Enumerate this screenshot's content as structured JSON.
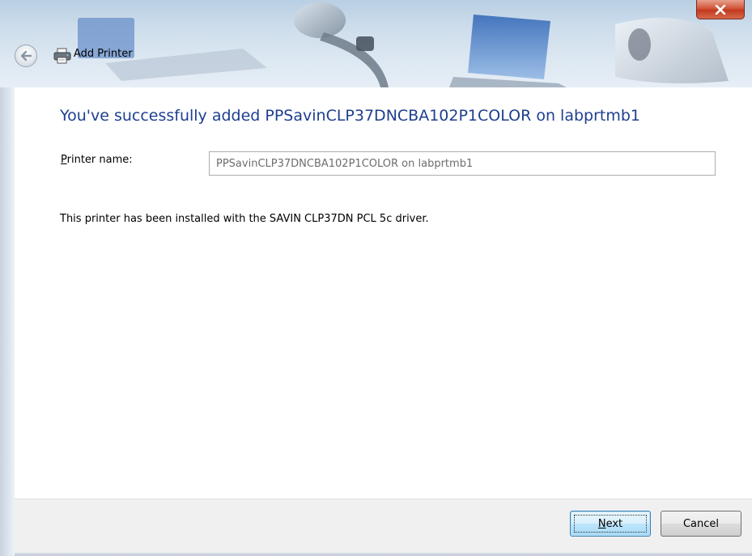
{
  "window": {
    "title": "Add Printer",
    "close_label": "x"
  },
  "main": {
    "heading": "You've successfully added PPSavinCLP37DNCBA102P1COLOR on labprtmb1",
    "printer_name_label_mnemonic": "P",
    "printer_name_label_rest": "rinter name:",
    "printer_name_value": "PPSavinCLP37DNCBA102P1COLOR on labprtmb1",
    "driver_message": "This printer has been installed with the SAVIN CLP37DN PCL 5c driver."
  },
  "footer": {
    "next_mnemonic": "N",
    "next_rest": "ext",
    "cancel_label": "Cancel"
  },
  "colors": {
    "heading": "#1e3f8f",
    "close": "#c23a1f",
    "footer_bg": "#f0f0f0"
  },
  "icons": {
    "back": "back-arrow-icon",
    "title": "printer-icon",
    "close": "close-icon"
  }
}
